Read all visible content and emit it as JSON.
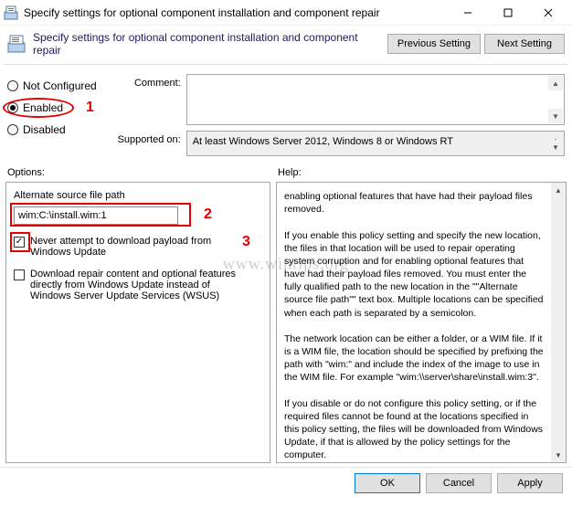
{
  "window": {
    "title": "Specify settings for optional component installation and component repair",
    "minimize_icon": "minimize-icon",
    "maximize_icon": "maximize-icon",
    "close_icon": "close-icon"
  },
  "header": {
    "title": "Specify settings for optional component installation and component repair",
    "prev": "Previous Setting",
    "next": "Next Setting"
  },
  "state": {
    "not_configured": "Not Configured",
    "enabled": "Enabled",
    "disabled": "Disabled",
    "selected": "enabled"
  },
  "comment": {
    "label": "Comment:",
    "value": ""
  },
  "supported": {
    "label": "Supported on:",
    "value": "At least Windows Server 2012, Windows 8 or Windows RT"
  },
  "options": {
    "label": "Options:",
    "alt_path_label": "Alternate source file path",
    "alt_path_value": "wim:C:\\install.wim:1",
    "chk_never_label": "Never attempt to download payload from Windows Update",
    "chk_never_checked": true,
    "chk_wsus_label": "Download repair content and optional features directly from Windows Update instead of Windows Server Update Services (WSUS)",
    "chk_wsus_checked": false
  },
  "help": {
    "label": "Help:",
    "text": "enabling optional features that have had their payload files removed.\n\nIf you enable this policy setting and specify the new location, the files in that location will be used to repair operating system corruption and for enabling optional features that have had their payload files removed. You must enter the fully qualified path to the new location in the \"\"Alternate source file path\"\" text box. Multiple locations can be specified when each path is separated by a semicolon.\n\nThe network location can be either a folder, or a WIM file. If it is a WIM file, the location should be specified by prefixing the path with \"wim:\" and include the index of the image to use in the WIM file. For example \"wim:\\\\server\\share\\install.wim:3\".\n\nIf you disable or do not configure this policy setting, or if the required files cannot be found at the locations specified in this policy setting, the files will be downloaded from Windows Update, if that is allowed by the policy settings for the computer."
  },
  "footer": {
    "ok": "OK",
    "cancel": "Cancel",
    "apply": "Apply"
  },
  "annotations": {
    "n1": "1",
    "n2": "2",
    "n3": "3"
  },
  "watermark": "www.wintips.org"
}
